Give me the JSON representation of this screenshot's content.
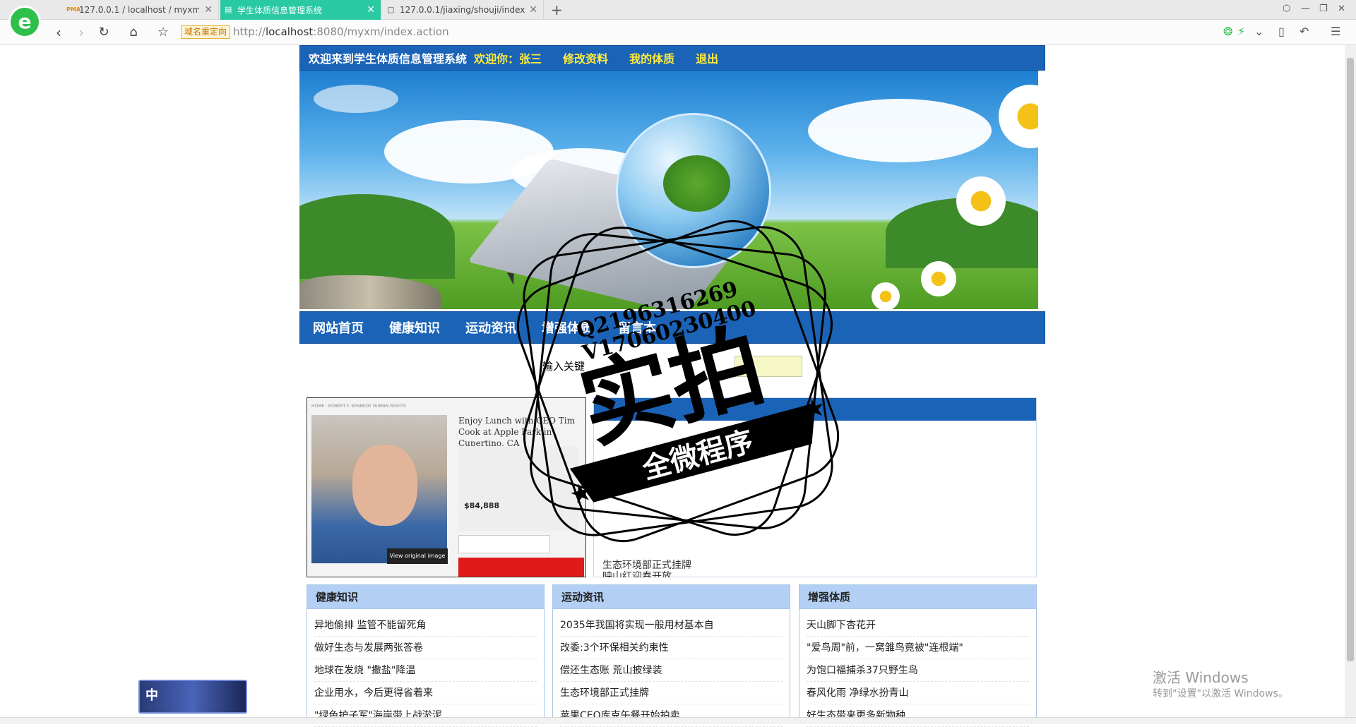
{
  "browser": {
    "tabs": [
      {
        "label": "127.0.0.1 / localhost / myxm",
        "favicon": "PMA"
      },
      {
        "label": "学生体质信息管理系统",
        "favicon": "doc"
      },
      {
        "label": "127.0.0.1/jiaxing/shouji/index",
        "favicon": "doc"
      }
    ],
    "redirect_badge": "域名重定向",
    "url_prefix": "http://",
    "url_host": "localhost",
    "url_rest": ":8080/myxm/index.action"
  },
  "topbar": {
    "site_welcome": "欢迎来到学生体质信息管理系统",
    "hello": "欢迎你：",
    "username": "张三",
    "edit_profile": "修改资料",
    "my_fitness": "我的体质",
    "logout": "退出"
  },
  "mainnav": {
    "items": [
      "网站首页",
      "健康知识",
      "运动资讯",
      "增强体质",
      "留言本"
    ]
  },
  "search": {
    "label": "输入关键",
    "value": ""
  },
  "featured_photo": {
    "headline": "Enjoy Lunch with CEO Tim Cook at Apple Park in Cupertino, CA",
    "price": "$84,888",
    "view_button": "View original image"
  },
  "news_list": {
    "items": [
      "生态环境部正式挂牌",
      "映山红迎春开放"
    ]
  },
  "columns": [
    {
      "title": "健康知识",
      "items": [
        "异地偷排 监管不能留死角",
        "做好生态与发展两张答卷",
        "地球在发烧 \"撒盐\"降温",
        "企业用水，今后更得省着来",
        "\"绿色护子军\"海岸带上战淤泥"
      ]
    },
    {
      "title": "运动资讯",
      "items": [
        "2035年我国将实现一般用材基本自",
        "改委:3个环保相关约束性",
        "偿还生态账 荒山披绿装",
        "生态环境部正式挂牌",
        "苹果CEO库克午餐开始拍卖"
      ]
    },
    {
      "title": "增强体质",
      "items": [
        "天山脚下杏花开",
        "\"爱鸟周\"前，一窝雏鸟竟被\"连根端\"",
        "为饱口福捕杀37只野生鸟",
        "春风化雨 净绿水扮青山",
        "好生态带来更多新物种"
      ]
    }
  ],
  "watermark": {
    "qq": "Q2196316269",
    "wechat": "V17060230400",
    "big": "实拍",
    "ribbon": "全微程序"
  },
  "windows_activation": {
    "title": "激活 Windows",
    "subtitle": "转到\"设置\"以激活 Windows。"
  },
  "ime": {
    "label": "中"
  },
  "colors": {
    "nav_blue": "#1b63b7",
    "nav_yellow": "#ffeb3b",
    "column_header": "#b3cff3",
    "active_tab": "#29c9a2"
  }
}
